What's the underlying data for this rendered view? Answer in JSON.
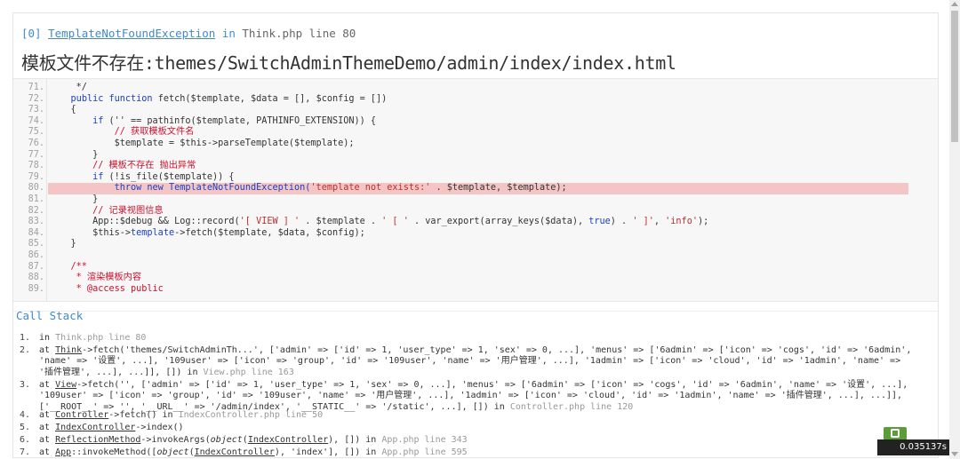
{
  "exception": {
    "index": "[0]",
    "class_name": "TemplateNotFoundException",
    "in_word": "in",
    "location": "Think.php line 80",
    "message": "模板文件不存在:themes/SwitchAdminThemeDemo/admin/index/index.html"
  },
  "code_lines": [
    {
      "n": "71.",
      "parts": [
        {
          "t": "     */",
          "c": "c-com2"
        }
      ]
    },
    {
      "n": "72.",
      "parts": [
        {
          "t": "    ",
          "c": ""
        },
        {
          "t": "public function",
          "c": "c-kw"
        },
        {
          "t": " fetch($template, $data = [], $config = [])",
          "c": ""
        }
      ]
    },
    {
      "n": "73.",
      "parts": [
        {
          "t": "    {",
          "c": ""
        }
      ]
    },
    {
      "n": "74.",
      "parts": [
        {
          "t": "        ",
          "c": ""
        },
        {
          "t": "if",
          "c": "c-kw"
        },
        {
          "t": " ('' == pathinfo($template, PATHINFO_EXTENSION)) {",
          "c": ""
        }
      ]
    },
    {
      "n": "75.",
      "parts": [
        {
          "t": "            // 获取模板文件名",
          "c": "c-com"
        }
      ]
    },
    {
      "n": "76.",
      "parts": [
        {
          "t": "            $template = $this->parseTemplate($template);",
          "c": ""
        }
      ]
    },
    {
      "n": "77.",
      "parts": [
        {
          "t": "        }",
          "c": ""
        }
      ]
    },
    {
      "n": "78.",
      "parts": [
        {
          "t": "        // 模板不存在 抛出异常",
          "c": "c-com"
        }
      ]
    },
    {
      "n": "79.",
      "parts": [
        {
          "t": "        ",
          "c": ""
        },
        {
          "t": "if",
          "c": "c-kw"
        },
        {
          "t": " (!is_file($template)) {",
          "c": ""
        }
      ]
    },
    {
      "n": "80.",
      "hl": true,
      "parts": [
        {
          "t": "            ",
          "c": ""
        },
        {
          "t": "throw new",
          "c": "c-kw"
        },
        {
          "t": " TemplateNotFoundException(",
          "c": "c-kw"
        },
        {
          "t": "'template not exists:'",
          "c": "c-str"
        },
        {
          "t": " . $template, $template);",
          "c": ""
        }
      ]
    },
    {
      "n": "81.",
      "parts": [
        {
          "t": "        }",
          "c": ""
        }
      ]
    },
    {
      "n": "82.",
      "parts": [
        {
          "t": "        // 记录视图信息",
          "c": "c-com"
        }
      ]
    },
    {
      "n": "83.",
      "parts": [
        {
          "t": "        App::$debug && Log::record(",
          "c": ""
        },
        {
          "t": "'[ VIEW ] '",
          "c": "c-str"
        },
        {
          "t": " . $template . ",
          "c": ""
        },
        {
          "t": "' [ '",
          "c": "c-str"
        },
        {
          "t": " . var_export(array_keys($data), ",
          "c": ""
        },
        {
          "t": "true",
          "c": "c-kw"
        },
        {
          "t": ") . ",
          "c": ""
        },
        {
          "t": "' ]'",
          "c": "c-str"
        },
        {
          "t": ", ",
          "c": ""
        },
        {
          "t": "'info'",
          "c": "c-str"
        },
        {
          "t": ");",
          "c": ""
        }
      ]
    },
    {
      "n": "84.",
      "parts": [
        {
          "t": "        $this->",
          "c": ""
        },
        {
          "t": "template",
          "c": "c-kw"
        },
        {
          "t": "->fetch($template, $data, $config);",
          "c": ""
        }
      ]
    },
    {
      "n": "85.",
      "parts": [
        {
          "t": "    }",
          "c": ""
        }
      ]
    },
    {
      "n": "86.",
      "parts": [
        {
          "t": "",
          "c": ""
        }
      ]
    },
    {
      "n": "87.",
      "parts": [
        {
          "t": "    /**",
          "c": "c-com"
        }
      ]
    },
    {
      "n": "88.",
      "parts": [
        {
          "t": "     * 渲染模板内容",
          "c": "c-com"
        }
      ]
    },
    {
      "n": "89.",
      "parts": [
        {
          "t": "     * @access public",
          "c": "c-com"
        }
      ]
    }
  ],
  "call_stack": {
    "title": "Call Stack",
    "items": [
      {
        "n": "1.",
        "parts": [
          {
            "t": "in ",
            "c": ""
          },
          {
            "t": "Think.php line 80",
            "c": "meta"
          }
        ]
      },
      {
        "n": "2.",
        "parts": [
          {
            "t": "at ",
            "c": ""
          },
          {
            "t": "Think",
            "c": "u"
          },
          {
            "t": "->fetch('themes/SwitchAdminTh...', ['admin' => ['id' => 1, 'user_type' => 1, 'sex' => 0, ...], 'menus' => ['6admin' => ['icon' => 'cogs', 'id' => '6admin', 'name' => '设置', ...], '109user' => ['icon' => 'group', 'id' => '109user', 'name' => '用户管理', ...], '1admin' => ['icon' => 'cloud', 'id' => '1admin', 'name' => '插件管理', ...], ...]], []) in ",
            "c": ""
          },
          {
            "t": "View.php line 163",
            "c": "meta"
          }
        ]
      },
      {
        "n": "3.",
        "parts": [
          {
            "t": "at ",
            "c": ""
          },
          {
            "t": "View",
            "c": "u"
          },
          {
            "t": "->fetch('', ['admin' => ['id' => 1, 'user_type' => 1, 'sex' => 0, ...], 'menus' => ['6admin' => ['icon' => 'cogs', 'id' => '6admin', 'name' => '设置', ...], '109user' => ['icon' => 'group', 'id' => '109user', 'name' => '用户管理', ...], '1admin' => ['icon' => 'cloud', 'id' => '1admin', 'name' => '插件管理', ...], ...]], ['__ROOT__' => '', '__URL__' => '/admin/index', '__STATIC__' => '/static', ...], []) in ",
            "c": ""
          },
          {
            "t": "Controller.php line 120",
            "c": "meta"
          }
        ]
      },
      {
        "n": "4.",
        "parts": [
          {
            "t": "at ",
            "c": ""
          },
          {
            "t": "Controller",
            "c": "u"
          },
          {
            "t": "->fetch() in ",
            "c": ""
          },
          {
            "t": "IndexController.php line 50",
            "c": "meta"
          }
        ]
      },
      {
        "n": "5.",
        "parts": [
          {
            "t": "at ",
            "c": ""
          },
          {
            "t": "IndexController",
            "c": "u"
          },
          {
            "t": "->index()",
            "c": ""
          }
        ]
      },
      {
        "n": "6.",
        "parts": [
          {
            "t": "at ",
            "c": ""
          },
          {
            "t": "ReflectionMethod",
            "c": "u"
          },
          {
            "t": "->invokeArgs(",
            "c": ""
          },
          {
            "t": "object",
            "c": "it"
          },
          {
            "t": "(",
            "c": ""
          },
          {
            "t": "IndexController",
            "c": "u"
          },
          {
            "t": "), []) in ",
            "c": ""
          },
          {
            "t": "App.php line 343",
            "c": "meta"
          }
        ]
      },
      {
        "n": "7.",
        "parts": [
          {
            "t": "at ",
            "c": ""
          },
          {
            "t": "App",
            "c": "u"
          },
          {
            "t": "::invokeMethod([",
            "c": ""
          },
          {
            "t": "object",
            "c": "it"
          },
          {
            "t": "(",
            "c": ""
          },
          {
            "t": "IndexController",
            "c": "u"
          },
          {
            "t": "), 'index'], []) in ",
            "c": ""
          },
          {
            "t": "App.php line 595",
            "c": "meta"
          }
        ]
      }
    ]
  },
  "debug_badge": {
    "time": "0.035137s"
  }
}
